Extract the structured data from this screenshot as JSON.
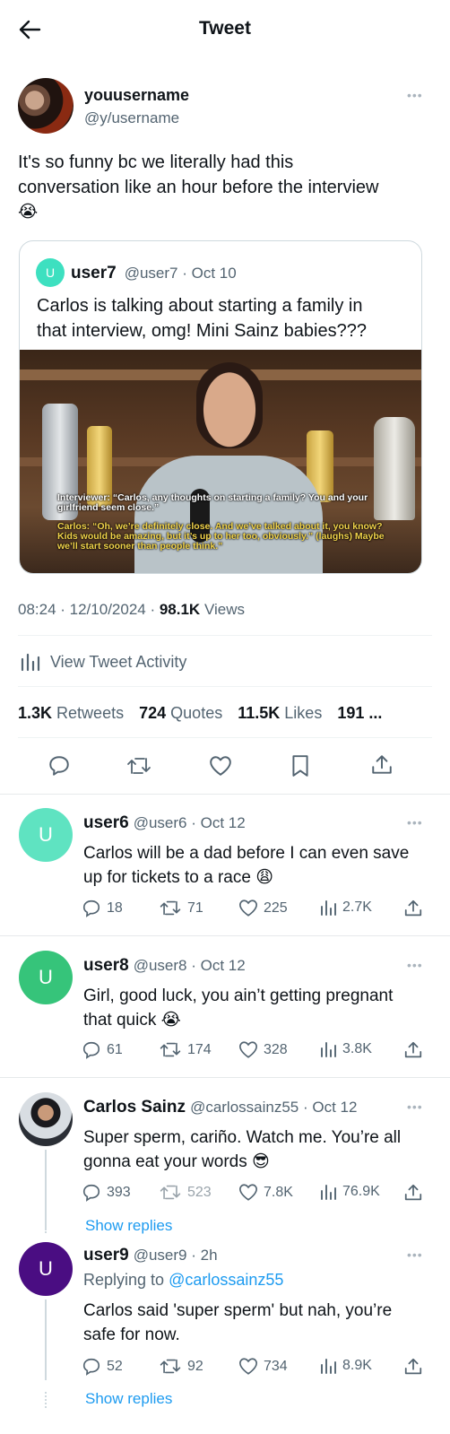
{
  "header": {
    "title": "Tweet"
  },
  "tweet": {
    "name": "youusername",
    "handle": "@y/username",
    "text_line1": "It's so funny bc we literally had this",
    "text_line2": "conversation like an hour before the interview",
    "text_emoji": "😭",
    "time": "08:24 · 12/10/2024 · ",
    "views_count": "98.1K",
    "views_label": "Views",
    "activity_label": "View Tweet Activity",
    "stats": {
      "retweets_count": "1.3K",
      "retweets_label": "Retweets",
      "quotes_count": "724",
      "quotes_label": "Quotes",
      "likes_count": "11.5K",
      "likes_label": "Likes",
      "bookmarks_count": "191 ..."
    }
  },
  "quote": {
    "avatar_letter": "U",
    "name": "user7",
    "meta": "@user7 · Oct 10",
    "text_line1": "Carlos is talking about starting a family in",
    "text_line2": "that interview, omg! Mini Sainz babies???",
    "caption_interviewer": "Interviewer: “Carlos, any thoughts on starting a family? You and your girlfriend seem close.”",
    "caption_carlos": "Carlos: “Oh, we’re definitely close. And we’ve talked about it, you know? Kids would be amazing, but it’s up to her too, obviously.” (laughs) Maybe we’ll start sooner than people think.”"
  },
  "colors": {
    "accent": "#1d9bf0",
    "muted": "#536471",
    "quote_avatar": "#3de0c0"
  },
  "replies": [
    {
      "avatar_letter": "U",
      "avatar_color": "#5fe3c1",
      "name": "user6",
      "meta": "@user6 · Oct 12",
      "line1": "Carlos will be a dad before I can even save",
      "line2": "up for tickets to a race 😩",
      "replies": "18",
      "retweets": "71",
      "likes": "225",
      "views": "2.7K"
    },
    {
      "avatar_letter": "U",
      "avatar_color": "#36c47a",
      "name": "user8",
      "meta": "@user8 · Oct 12",
      "line1": "Girl, good luck, you ain’t getting pregnant",
      "line2": "that quick 😭",
      "replies": "61",
      "retweets": "174",
      "likes": "328",
      "views": "3.8K"
    },
    {
      "name": "Carlos Sainz",
      "meta": "@carlossainz55 · Oct 12",
      "line1": "Super sperm, cariño. Watch me. You’re all",
      "line2": "gonna eat your words 😎",
      "replies": "393",
      "retweets": "523",
      "likes": "7.8K",
      "views": "76.9K",
      "show_replies": "Show replies"
    },
    {
      "avatar_letter": "U",
      "avatar_color": "#4a0d82",
      "name": "user9",
      "meta": "@user9 · 2h",
      "replying_label": "Replying to ",
      "replying_handle": "@carlossainz55",
      "line1": "Carlos said 'super sperm' but nah, you’re",
      "line2": "safe for now.",
      "replies": "52",
      "retweets": "92",
      "likes": "734",
      "views": "8.9K",
      "show_replies": "Show replies"
    }
  ],
  "icons": [
    "back-arrow-icon",
    "more-icon",
    "reply-icon",
    "retweet-icon",
    "like-icon",
    "bookmark-icon",
    "share-icon",
    "views-icon",
    "activity-icon"
  ]
}
